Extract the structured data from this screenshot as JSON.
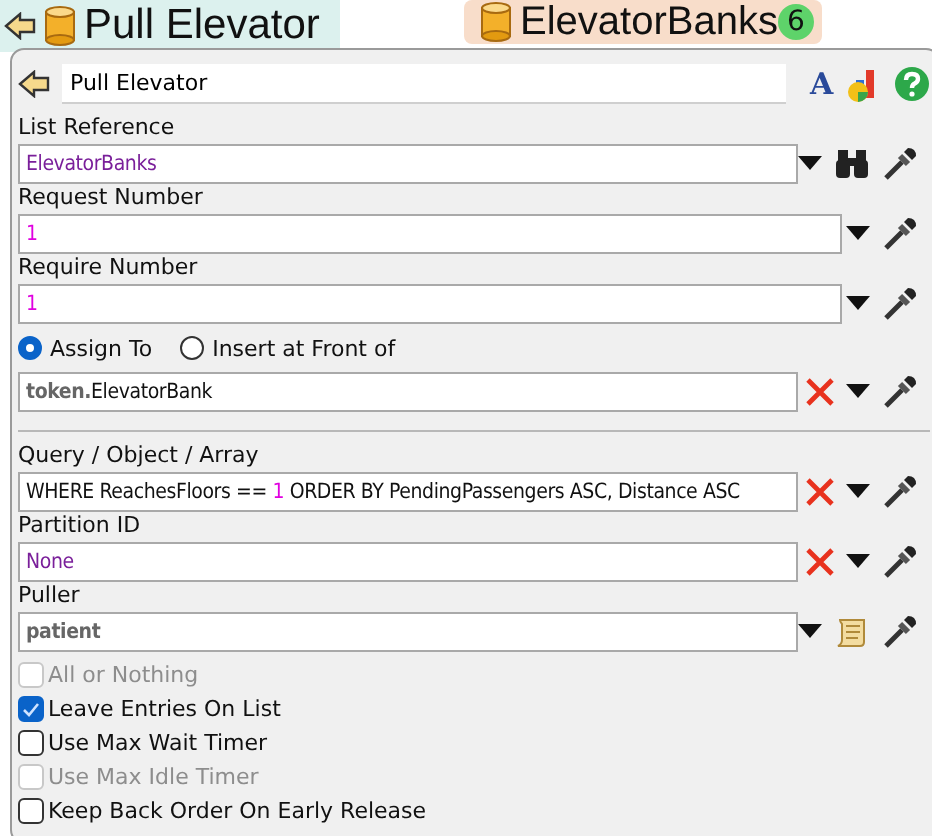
{
  "canvas": {
    "node_title": "Pull Elevator",
    "chip": {
      "label": "ElevatorBanks",
      "badge": "6"
    }
  },
  "panel": {
    "name": "Pull Elevator",
    "font_button": "A",
    "fields": [
      {
        "kind": "list",
        "label": "List Reference",
        "value": [
          {
            "text": "ElevatorBanks",
            "kind": "reference"
          }
        ]
      },
      {
        "kind": "value",
        "label": "Request Number",
        "value": [
          {
            "text": "1",
            "kind": "number"
          }
        ]
      },
      {
        "kind": "value",
        "label": "Require Number",
        "value": [
          {
            "text": "1",
            "kind": "number"
          }
        ]
      },
      {
        "kind": "assign",
        "options": [
          {
            "label": "Assign To",
            "selected": true
          },
          {
            "label": "Insert at Front of",
            "selected": false
          }
        ],
        "value": [
          {
            "text": "token.",
            "kind": "keyword"
          },
          {
            "text": "ElevatorBank",
            "kind": "plain"
          }
        ]
      },
      {
        "kind": "query",
        "label": "Query / Object / Array",
        "value": [
          {
            "text": "WHERE ReachesFloors == ",
            "kind": "plain"
          },
          {
            "text": "1",
            "kind": "number"
          },
          {
            "text": " ORDER BY PendingPassengers ASC, Distance ASC",
            "kind": "plain"
          }
        ]
      },
      {
        "kind": "query",
        "label": "Partition ID",
        "value": [
          {
            "text": "None",
            "kind": "reference"
          }
        ]
      },
      {
        "kind": "puller",
        "label": "Puller",
        "value": [
          {
            "text": "patient",
            "kind": "keyword"
          }
        ]
      }
    ],
    "checkboxes": [
      {
        "label": "All or Nothing",
        "checked": false,
        "disabled": true
      },
      {
        "label": "Leave Entries On List",
        "checked": true,
        "disabled": false
      },
      {
        "label": "Use Max Wait Timer",
        "checked": false,
        "disabled": false
      },
      {
        "label": "Use Max Idle Timer",
        "checked": false,
        "disabled": true
      },
      {
        "label": "Keep Back Order On Early Release",
        "checked": false,
        "disabled": false
      }
    ]
  }
}
